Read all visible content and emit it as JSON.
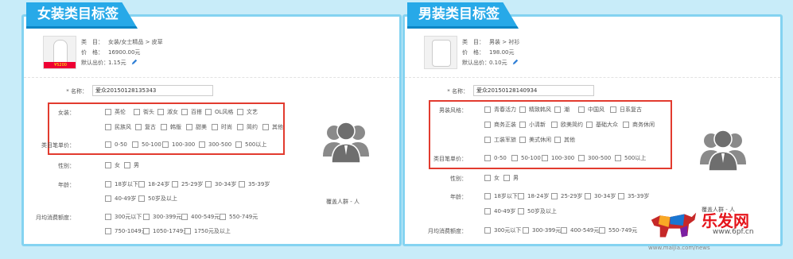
{
  "left": {
    "title": "女装类目标签",
    "product": {
      "category_label": "类　目：",
      "category": "女装/女士精品 > 皮草",
      "price_label": "价　格：",
      "price": "16900.00元",
      "default_bid_label": "默认出价：",
      "default_bid": "1.15元",
      "thumb_badge": "¥5200"
    },
    "name_label": "* 名称：",
    "name_value": "爱众20150128135343",
    "group_label": "女装：",
    "options_row1": [
      "英伦",
      "街头",
      "淑女",
      "百搭",
      "OL风格",
      "文艺"
    ],
    "options_row2": [
      "民族风",
      "复古",
      "韩版",
      "甜美",
      "时尚",
      "简约",
      "其他"
    ],
    "price_label": "类目笔单价：",
    "price_options": [
      "0-50",
      "50-100",
      "100-300",
      "300-500",
      "500以上"
    ],
    "gender_label": "性别：",
    "gender_options": [
      "女",
      "男"
    ],
    "age_label": "年龄：",
    "age_options_row1": [
      "18岁以下",
      "18-24岁",
      "25-29岁",
      "30-34岁",
      "35-39岁"
    ],
    "age_options_row2": [
      "40-49岁",
      "50岁及以上"
    ],
    "spend_label": "月均消费额度：",
    "spend_options_row1": [
      "300元以下",
      "300-399元",
      "400-549元",
      "550-749元"
    ],
    "spend_options_row2": [
      "750-1049元",
      "1050-1749元",
      "1750元及以上"
    ],
    "cover_label": "覆盖人群 - 人"
  },
  "right": {
    "title": "男装类目标签",
    "product": {
      "category_label": "类　目：",
      "category": "男装 > 衬衫",
      "price_label": "价　格：",
      "price": "198.00元",
      "default_bid_label": "默认出价：",
      "default_bid": "0.10元"
    },
    "name_label": "* 名称：",
    "name_value": "爱众20150128140934",
    "group_label": "男装风格：",
    "options_row1": [
      "青春活力",
      "精致韩风",
      "潮",
      "中国风",
      "日系复古"
    ],
    "options_row2": [
      "商务正装",
      "小清新",
      "欧美简约",
      "基础大众",
      "商务休闲"
    ],
    "options_row3": [
      "工装军旅",
      "美式休闲",
      "其他"
    ],
    "price_label": "类目笔单价：",
    "price_options": [
      "0-50",
      "50-100",
      "100-300",
      "300-500",
      "500以上"
    ],
    "gender_label": "性别：",
    "gender_options": [
      "女",
      "男"
    ],
    "age_label": "年龄：",
    "age_options_row1": [
      "18岁以下",
      "18-24岁",
      "25-29岁",
      "30-34岁",
      "35-39岁"
    ],
    "age_options_row2": [
      "40-49岁",
      "50岁及以上"
    ],
    "spend_label": "月均消费额度：",
    "spend_options_row1": [
      "300元以下",
      "300-399元",
      "400-549元",
      "550-749元"
    ],
    "cover_label": "覆盖人群 - 人"
  },
  "logo": {
    "brand": "乐发网",
    "site": "www.6pf.cn",
    "watermark": "www.maijia.com/news"
  },
  "colors": {
    "accent": "#27a9e8",
    "panel_border": "#84d3f1",
    "highlight": "#e23b2f",
    "background": "#c8ecf9"
  }
}
